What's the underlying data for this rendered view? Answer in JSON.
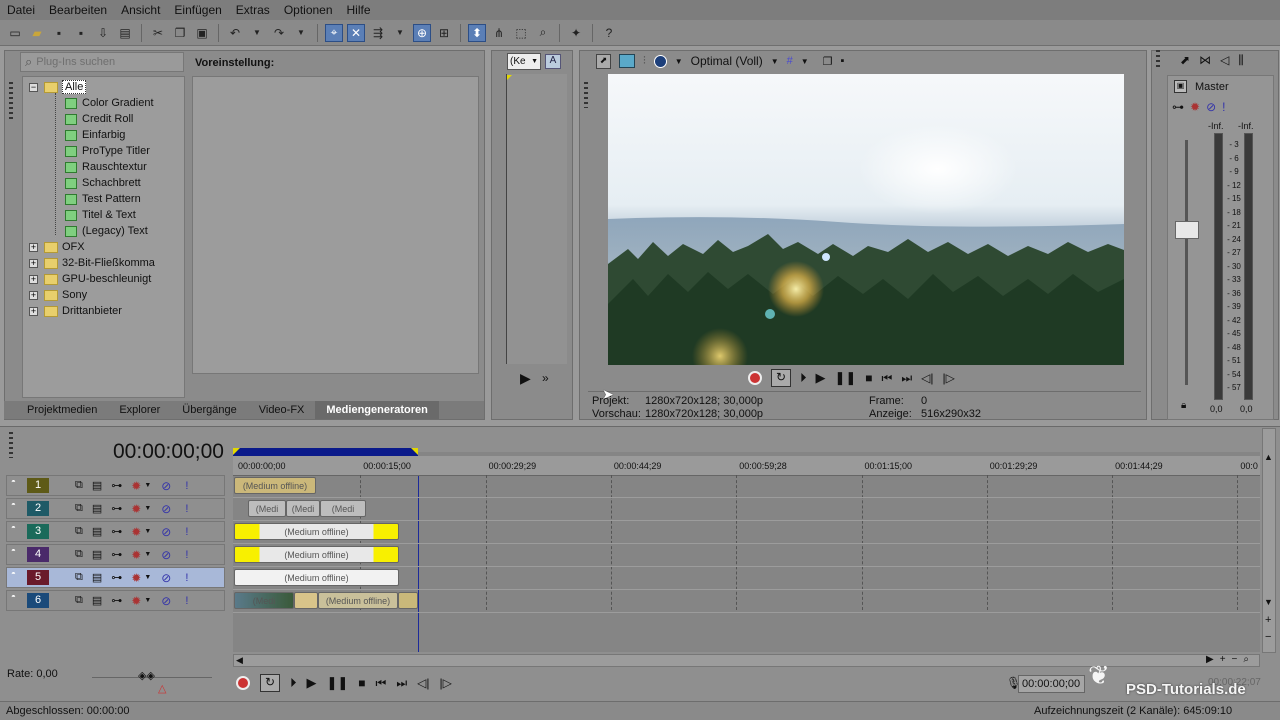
{
  "menu": [
    "Datei",
    "Bearbeiten",
    "Ansicht",
    "Einfügen",
    "Extras",
    "Optionen",
    "Hilfe"
  ],
  "plugins": {
    "search_placeholder": "Plug-Ins suchen",
    "preset_label": "Voreinstellung:",
    "tree": [
      {
        "label": "Alle",
        "type": "folder",
        "expanded": true,
        "selected": true,
        "level": 0
      },
      {
        "label": "Color Gradient",
        "type": "plugin",
        "level": 1
      },
      {
        "label": "Credit Roll",
        "type": "plugin",
        "level": 1
      },
      {
        "label": "Einfarbig",
        "type": "plugin",
        "level": 1
      },
      {
        "label": "ProType Titler",
        "type": "plugin",
        "level": 1
      },
      {
        "label": "Rauschtextur",
        "type": "plugin",
        "level": 1
      },
      {
        "label": "Schachbrett",
        "type": "plugin",
        "level": 1
      },
      {
        "label": "Test Pattern",
        "type": "plugin",
        "level": 1
      },
      {
        "label": "Titel & Text",
        "type": "plugin",
        "level": 1
      },
      {
        "label": "(Legacy) Text",
        "type": "plugin",
        "level": 1
      },
      {
        "label": "OFX",
        "type": "folder",
        "level": 0
      },
      {
        "label": "32-Bit-Fließkomma",
        "type": "folder",
        "level": 0
      },
      {
        "label": "GPU-beschleunigt",
        "type": "folder",
        "level": 0
      },
      {
        "label": "Sony",
        "type": "folder",
        "level": 0
      },
      {
        "label": "Drittanbieter",
        "type": "folder",
        "level": 0
      }
    ]
  },
  "tabs": [
    "Projektmedien",
    "Explorer",
    "Übergänge",
    "Video-FX",
    "Mediengeneratoren"
  ],
  "active_tab": "Mediengeneratoren",
  "trimmer": {
    "dropdown": "(Ke"
  },
  "preview": {
    "quality": "Optimal (Voll)",
    "projekt_label": "Projekt:",
    "projekt_value": "1280x720x128; 30,000p",
    "vorschau_label": "Vorschau:",
    "vorschau_value": "1280x720x128; 30,000p",
    "frame_label": "Frame:",
    "frame_value": "0",
    "anzeige_label": "Anzeige:",
    "anzeige_value": "516x290x32"
  },
  "mixer": {
    "title": "Master",
    "left_inf": "-Inf.",
    "right_inf": "-Inf.",
    "scale": [
      "3",
      "6",
      "9",
      "12",
      "15",
      "18",
      "21",
      "24",
      "27",
      "30",
      "33",
      "36",
      "39",
      "42",
      "45",
      "48",
      "51",
      "54",
      "57"
    ],
    "left_value": "0,0",
    "right_value": "0,0"
  },
  "timeline": {
    "timecode": "00:00:00;00",
    "ruler": [
      "00:00:00;00",
      "00:00:15;00",
      "00:00:29;29",
      "00:00:44;29",
      "00:00:59;28",
      "00:01:15;00",
      "00:01:29;29",
      "00:01:44;29",
      "00:0"
    ],
    "clip_text": "(Medium offline)",
    "clip_text_short": "(Medi",
    "tracks": [
      {
        "num": "1",
        "color": "#5e5a17"
      },
      {
        "num": "2",
        "color": "#1e5a66"
      },
      {
        "num": "3",
        "color": "#1a6a5a"
      },
      {
        "num": "4",
        "color": "#4a2a6a"
      },
      {
        "num": "5",
        "color": "#6a1a2a"
      },
      {
        "num": "6",
        "color": "#1a4a7a"
      }
    ],
    "rate_label": "Rate: 0,00",
    "bottom_time": "00:00:00;00",
    "dim_time": "00:00:22;07"
  },
  "status": {
    "left": "Abgeschlossen: 00:00:00",
    "right": "Aufzeichnungszeit (2 Kanäle): 645:09:10"
  },
  "watermark": "PSD-Tutorials.de"
}
